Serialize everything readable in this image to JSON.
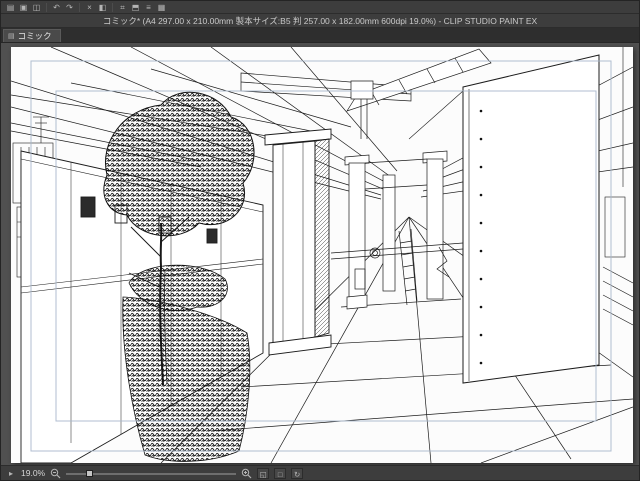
{
  "window": {
    "title": "コミック* (A4 297.00 x 210.00mm 製本サイズ:B5 判 257.00 x 182.00mm 600dpi 19.0%)  - CLIP STUDIO PAINT EX"
  },
  "command_bar": {
    "items": [
      {
        "name": "new-canvas",
        "glyph": "▤"
      },
      {
        "name": "open-file",
        "glyph": "▣"
      },
      {
        "name": "save-file",
        "glyph": "◫"
      },
      {
        "name": "undo",
        "glyph": "↶"
      },
      {
        "name": "redo",
        "glyph": "↷"
      },
      {
        "name": "delete",
        "glyph": "×"
      },
      {
        "name": "fill",
        "glyph": "◧"
      },
      {
        "name": "grid",
        "glyph": "⌗"
      },
      {
        "name": "snap",
        "glyph": "⬒"
      },
      {
        "name": "ruler",
        "glyph": "≡"
      },
      {
        "name": "settings",
        "glyph": "▦"
      }
    ]
  },
  "tab_bar": {
    "active_tab": "コミック",
    "tab_icon": "▤"
  },
  "status_bar": {
    "nav_glyph": "▸",
    "zoom_value": "19.0",
    "zoom_unit": "%",
    "fit_glyph": "◱",
    "actual_glyph": "□",
    "rotate_glyph": "↻"
  },
  "colors": {
    "chrome_bg": "#3d3d3d",
    "canvas_bg": "#505050",
    "paper": "#fcfcfc",
    "guide_line": "#a8b8cc",
    "ink_line": "#1c1c1c"
  }
}
